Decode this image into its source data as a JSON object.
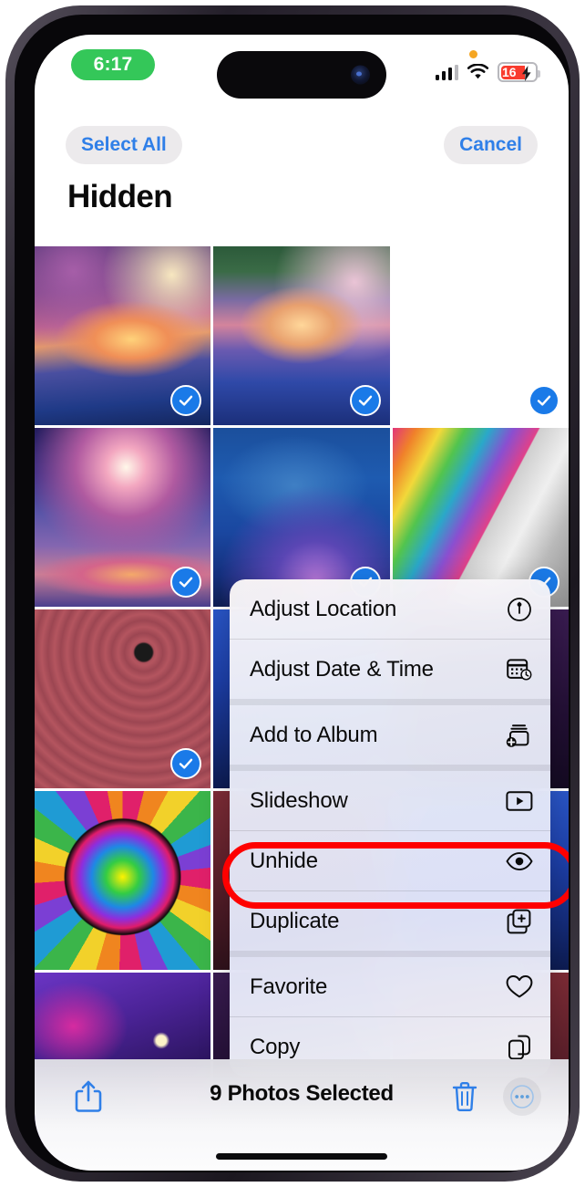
{
  "status_bar": {
    "time": "6:17",
    "time_pill_color": "#34c759",
    "mic_indicator": "orange-dot",
    "cellular_icon": "cellular-bars-icon",
    "wifi_icon": "wifi-icon",
    "battery_level": "16",
    "battery_color": "#f93b2e",
    "battery_charging": true
  },
  "nav": {
    "select_all_label": "Select All",
    "cancel_label": "Cancel",
    "title": "Hidden",
    "accent_color": "#2f7fe8"
  },
  "grid": {
    "photos": [
      {
        "name": "ocean-sunset-reef",
        "art": "art-ocean-sunset",
        "selected": true
      },
      {
        "name": "whale-waterfall-sunset",
        "art": "art-whale-falls",
        "selected": true
      },
      {
        "name": "waterfall-whales-reef",
        "art": "art-waterfall-whale",
        "selected": true
      },
      {
        "name": "cosmic-dolphin-sunset",
        "art": "art-cosmic-dolphin",
        "selected": true
      },
      {
        "name": "orcas-underwater-galaxy",
        "art": "art-orcas",
        "selected": true
      },
      {
        "name": "psychedelic-mushroom-collage",
        "art": "art-psychedelic-mushroom",
        "selected": true
      },
      {
        "name": "red-mandala-mountain",
        "art": "art-red-mandala",
        "selected": true
      },
      {
        "name": "blue-nebula",
        "art": "art-blue-nebula",
        "selected": false
      },
      {
        "name": "dark-purple-sky",
        "art": "art-dark-purple",
        "selected": false
      },
      {
        "name": "rainbow-flower-of-life",
        "art": "art-flower-of-life",
        "selected": false
      },
      {
        "name": "crimson-texture",
        "art": "art-crimson-texture",
        "selected": false
      },
      {
        "name": "blue-gradient",
        "art": "art-blue-nebula",
        "selected": false
      },
      {
        "name": "purple-night-sky-moon",
        "art": "art-night-sky",
        "selected": false
      },
      {
        "name": "dark-purple-2",
        "art": "art-dark-purple",
        "selected": false
      },
      {
        "name": "crimson-texture-2",
        "art": "art-crimson-texture",
        "selected": false
      }
    ],
    "checkmark_color": "#1a7ae8"
  },
  "context_menu": {
    "items": [
      {
        "label": "Adjust Location",
        "icon": "location-pin-circle-icon",
        "group_break_after": false
      },
      {
        "label": "Adjust Date & Time",
        "icon": "calendar-clock-icon",
        "group_break_after": true
      },
      {
        "label": "Add to Album",
        "icon": "add-to-album-icon",
        "group_break_after": true
      },
      {
        "label": "Slideshow",
        "icon": "play-rectangle-icon",
        "group_break_after": false
      },
      {
        "label": "Unhide",
        "icon": "eye-icon",
        "group_break_after": false
      },
      {
        "label": "Duplicate",
        "icon": "duplicate-icon",
        "group_break_after": true
      },
      {
        "label": "Favorite",
        "icon": "heart-icon",
        "group_break_after": false
      },
      {
        "label": "Copy",
        "icon": "copy-icon",
        "group_break_after": false
      }
    ],
    "highlighted_item": "Unhide",
    "highlight_color": "#fe0000"
  },
  "toolbar": {
    "share_icon": "share-up-arrow-icon",
    "selection_count_label": "9 Photos Selected",
    "delete_icon": "trash-icon",
    "more_icon": "ellipsis-circle-icon",
    "accent_color": "#2f7fe8"
  }
}
